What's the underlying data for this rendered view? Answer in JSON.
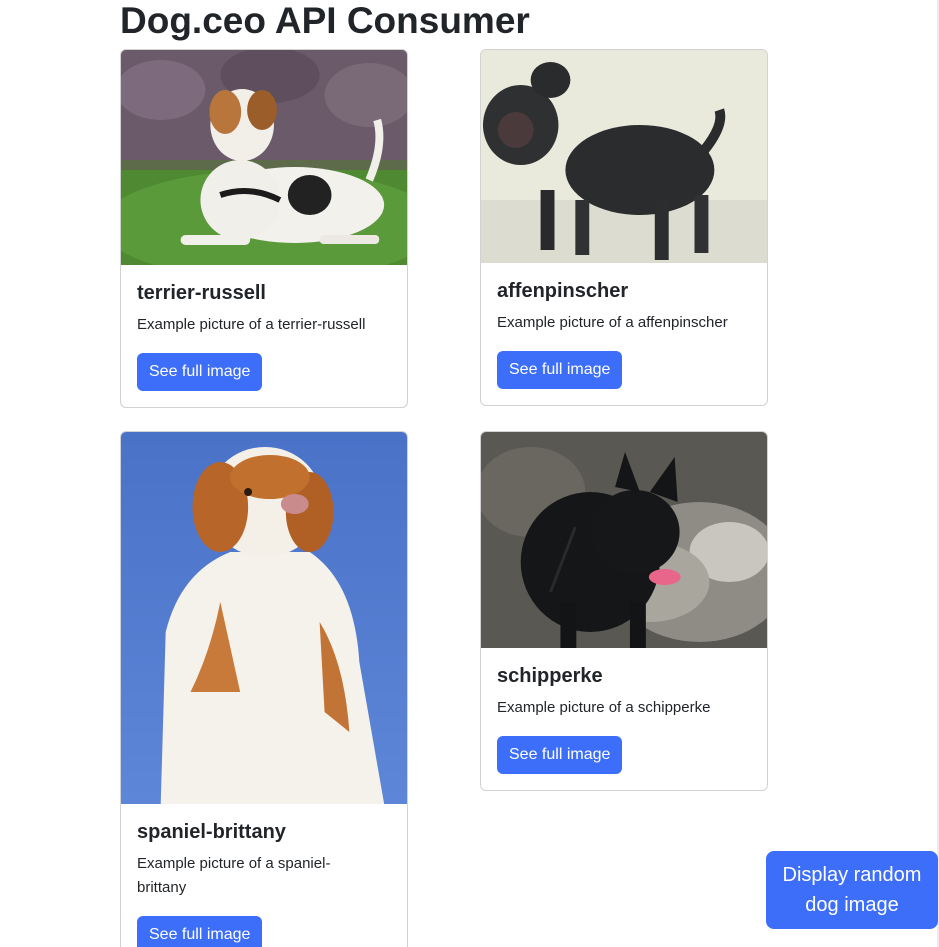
{
  "header": {
    "title": "Dog.ceo API Consumer"
  },
  "cards": [
    {
      "breed": "terrier-russell",
      "caption": "Example picture of a terrier-russell",
      "button_label": "See full image"
    },
    {
      "breed": "affenpinscher",
      "caption": "Example picture of a affenpinscher",
      "button_label": "See full image"
    },
    {
      "breed": "spaniel-brittany",
      "caption": "Example picture of a spaniel-brittany",
      "button_label": "See full image"
    },
    {
      "breed": "schipperke",
      "caption": "Example picture of a schipperke",
      "button_label": "See full image"
    }
  ],
  "random_button": {
    "label": "Display random dog image"
  },
  "colors": {
    "primary": "#3d6ef9",
    "text": "#212529",
    "card_border": "#dee2e6"
  }
}
